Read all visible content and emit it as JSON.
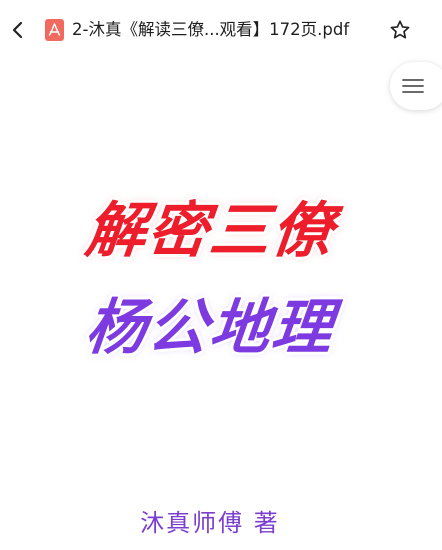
{
  "toolbar": {
    "title": "2-沐真《解读三僚...观看】172页.pdf",
    "back_icon": "chevron-left-icon",
    "file_icon": "pdf-file-icon",
    "favorite_icon": "star-outline-icon",
    "menu_icon": "hamburger-menu-icon"
  },
  "document": {
    "title_line1": "解密三僚",
    "title_line2": "杨公地理",
    "author": "沐真师傅  著"
  },
  "colors": {
    "title_line1": "#ee1d2b",
    "title_line2": "#7d3ae0",
    "author": "#7a3fcf",
    "pdf_icon": "#f16a60"
  }
}
